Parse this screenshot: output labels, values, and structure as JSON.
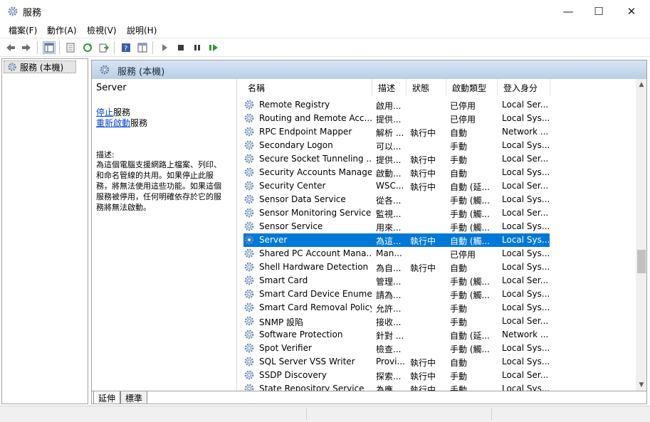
{
  "window": {
    "title": "服務",
    "minimize": "—",
    "maximize": "☐",
    "close": "✕"
  },
  "menu": [
    "檔案(F)",
    "動作(A)",
    "檢視(V)",
    "說明(H)"
  ],
  "tree": {
    "root_label": "服務 (本機)"
  },
  "panel": {
    "header_label": "服務 (本機)"
  },
  "details": {
    "service_name": "Server",
    "stop_link": "停止",
    "stop_suffix": "服務",
    "restart_link": "重新啟動",
    "restart_suffix": "服務",
    "desc_label": "描述:",
    "desc_lines": [
      "為這個電腦支援網路上檔案、列印、",
      "和命名管線的共用。如果停止此服",
      "務，將無法使用這些功能。如果這個",
      "服務被停用，任何明確依存於它的服",
      "務將無法啟動。"
    ]
  },
  "columns": {
    "name": "名稱",
    "desc": "描述",
    "status": "狀態",
    "startup": "啟動類型",
    "logon": "登入身分"
  },
  "services": [
    {
      "name": "Remote Registry",
      "desc": "啟用...",
      "status": "",
      "startup": "已停用",
      "logon": "Local Ser..."
    },
    {
      "name": "Routing and Remote Acc...",
      "desc": "提供...",
      "status": "",
      "startup": "已停用",
      "logon": "Local Sys..."
    },
    {
      "name": "RPC Endpoint Mapper",
      "desc": "解析 ...",
      "status": "執行中",
      "startup": "自動",
      "logon": "Network ..."
    },
    {
      "name": "Secondary Logon",
      "desc": "可以...",
      "status": "",
      "startup": "手動",
      "logon": "Local Sys..."
    },
    {
      "name": "Secure Socket Tunneling ...",
      "desc": "提供...",
      "status": "執行中",
      "startup": "手動",
      "logon": "Local Ser..."
    },
    {
      "name": "Security Accounts Manager",
      "desc": "啟動...",
      "status": "執行中",
      "startup": "自動",
      "logon": "Local Sys..."
    },
    {
      "name": "Security Center",
      "desc": "WSC...",
      "status": "執行中",
      "startup": "自動 (延...",
      "logon": "Local Ser..."
    },
    {
      "name": "Sensor Data Service",
      "desc": "從各...",
      "status": "",
      "startup": "手動 (觸...",
      "logon": "Local Sys..."
    },
    {
      "name": "Sensor Monitoring Service",
      "desc": "監視...",
      "status": "",
      "startup": "手動 (觸...",
      "logon": "Local Ser..."
    },
    {
      "name": "Sensor Service",
      "desc": "用來...",
      "status": "",
      "startup": "手動 (觸...",
      "logon": "Local Sys..."
    },
    {
      "name": "Server",
      "desc": "為這...",
      "status": "執行中",
      "startup": "自動 (觸...",
      "logon": "Local Sys..."
    },
    {
      "name": "Shared PC Account Mana...",
      "desc": "Man...",
      "status": "",
      "startup": "已停用",
      "logon": "Local Sys..."
    },
    {
      "name": "Shell Hardware Detection",
      "desc": "為自...",
      "status": "執行中",
      "startup": "自動",
      "logon": "Local Sys..."
    },
    {
      "name": "Smart Card",
      "desc": "管理...",
      "status": "",
      "startup": "手動 (觸...",
      "logon": "Local Ser..."
    },
    {
      "name": "Smart Card Device Enume...",
      "desc": "請為...",
      "status": "",
      "startup": "手動 (觸...",
      "logon": "Local Sys..."
    },
    {
      "name": "Smart Card Removal Policy",
      "desc": "允許...",
      "status": "",
      "startup": "手動",
      "logon": "Local Sys..."
    },
    {
      "name": "SNMP 設陷",
      "desc": "接收...",
      "status": "",
      "startup": "手動",
      "logon": "Local Ser..."
    },
    {
      "name": "Software Protection",
      "desc": "針對 ...",
      "status": "",
      "startup": "自動 (延...",
      "logon": "Network ..."
    },
    {
      "name": "Spot Verifier",
      "desc": "檢查...",
      "status": "",
      "startup": "手動 (觸...",
      "logon": "Local Sys..."
    },
    {
      "name": "SQL Server VSS Writer",
      "desc": "Provi...",
      "status": "執行中",
      "startup": "自動",
      "logon": "Local Sys..."
    },
    {
      "name": "SSDP Discovery",
      "desc": "探索...",
      "status": "執行中",
      "startup": "手動",
      "logon": "Local Ser..."
    },
    {
      "name": "State Repository Service",
      "desc": "為應...",
      "status": "執行中",
      "startup": "手動",
      "logon": "Local Sys..."
    }
  ],
  "selected_row": 10,
  "tabs": {
    "extended": "延伸",
    "standard": "標準"
  },
  "colors": {
    "selection": "#0078d7",
    "header_band": "#c9dcee",
    "link": "#0645c8"
  }
}
